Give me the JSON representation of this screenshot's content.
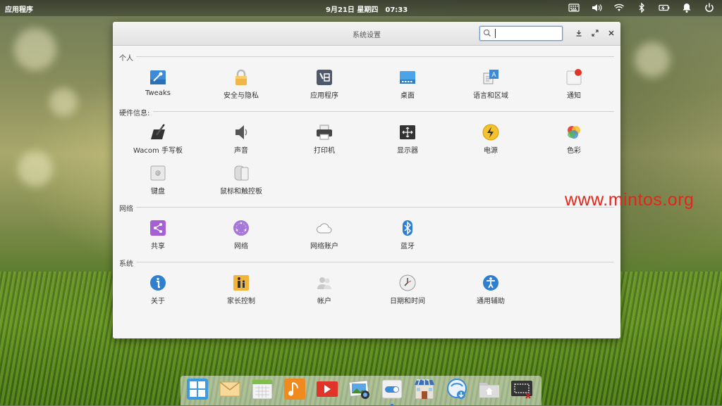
{
  "panel": {
    "apps_label": "应用程序",
    "date": "9月21日 星期四",
    "time": "07:33",
    "tray_icons": [
      "keyboard-icon",
      "volume-icon",
      "wifi-icon",
      "bluetooth-icon",
      "battery-icon",
      "notification-icon",
      "power-icon"
    ]
  },
  "window": {
    "title": "系统设置",
    "search": {
      "value": "",
      "placeholder": ""
    }
  },
  "sections": {
    "personal": {
      "title": "个人",
      "items": [
        {
          "label": "Tweaks",
          "icon": "tweaks-icon"
        },
        {
          "label": "安全与隐私",
          "icon": "lock-icon"
        },
        {
          "label": "应用程序",
          "icon": "applications-icon"
        },
        {
          "label": "桌面",
          "icon": "desktop-icon"
        },
        {
          "label": "语言和区域",
          "icon": "language-icon"
        },
        {
          "label": "通知",
          "icon": "notification-icon"
        }
      ]
    },
    "hardware": {
      "title": "硬件信息:",
      "items": [
        {
          "label": "Wacom 手写板",
          "icon": "tablet-icon"
        },
        {
          "label": "声音",
          "icon": "speaker-icon"
        },
        {
          "label": "打印机",
          "icon": "printer-icon"
        },
        {
          "label": "显示器",
          "icon": "display-icon"
        },
        {
          "label": "电源",
          "icon": "power-icon"
        },
        {
          "label": "色彩",
          "icon": "color-icon"
        },
        {
          "label": "键盘",
          "icon": "keyboard-icon"
        },
        {
          "label": "鼠标和触控板",
          "icon": "mouse-icon"
        }
      ]
    },
    "network": {
      "title": "网络",
      "items": [
        {
          "label": "共享",
          "icon": "share-icon"
        },
        {
          "label": "网络",
          "icon": "network-icon"
        },
        {
          "label": "网络账户",
          "icon": "cloud-icon"
        },
        {
          "label": "蓝牙",
          "icon": "bluetooth-icon"
        }
      ]
    },
    "system": {
      "title": "系统",
      "items": [
        {
          "label": "关于",
          "icon": "info-icon"
        },
        {
          "label": "家长控制",
          "icon": "parental-icon"
        },
        {
          "label": "帐户",
          "icon": "users-icon"
        },
        {
          "label": "日期和时间",
          "icon": "clock-icon"
        },
        {
          "label": "通用辅助",
          "icon": "accessibility-icon"
        }
      ]
    }
  },
  "dock": {
    "items": [
      "multitasking-icon",
      "mail-icon",
      "calendar-icon",
      "music-icon",
      "video-icon",
      "photos-icon",
      "settings-icon",
      "app-center-icon",
      "browser-icon",
      "files-icon",
      "screenshot-icon"
    ]
  },
  "watermark": "www.mintos.org"
}
